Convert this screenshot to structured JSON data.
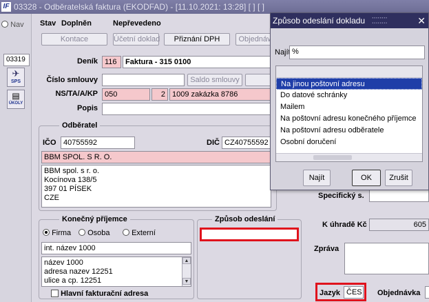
{
  "window": {
    "app_icon": "IF",
    "title": "03328 - Odběratelská faktura (EKODFAD) - [11.10.2021: 13:28]  [ ]  [ ]"
  },
  "left": {
    "nav_label": "Nav",
    "doc_number": "03319",
    "sps_label": "SPS",
    "ukoly_label": "ÚKOLY"
  },
  "status": {
    "stav_label": "Stav",
    "stav_value": "Doplněn",
    "prevod_value": "Nepřevedeno"
  },
  "toolbar": {
    "kontace": "Kontace",
    "ucetni_doklad": "Účetní doklad",
    "priznani_dph": "Přiznání DPH",
    "objednavky": "Objednáv"
  },
  "header": {
    "denik_label": "Deník",
    "denik_code": "116",
    "denik_name": "Faktura - 315 0100",
    "cislo_smlouvy_label": "Číslo smlouvy",
    "cislo_smlouvy_value": "",
    "saldo_button": "Saldo smlouvy",
    "ns_label": "NS/TA/A/KP",
    "ns_value": "050",
    "ta_value": "2",
    "a_value": "1009 zakázka 8786",
    "popis_label": "Popis",
    "popis_value": ""
  },
  "odberatel": {
    "title": "Odběratel",
    "ico_label": "IČO",
    "ico_value": "40755592",
    "dic_label": "DIČ",
    "dic_value": "CZ40755592",
    "name": "BBM SPOL. S R. O.",
    "address_lines": [
      "BBM spol. s r. o.",
      "Kocínova 138/5",
      "397 01 PÍSEK",
      "CZE"
    ]
  },
  "konecny_prijemce": {
    "title": "Konečný příjemce",
    "options": [
      "Firma",
      "Osoba",
      "Externí"
    ],
    "selected": "Firma",
    "name_value": "int. název 1000",
    "address_lines": [
      "název 1000",
      "adresa nazev 12251",
      "ulice a cp. 12251"
    ],
    "hlavni_label": "Hlavní fakturační adresa"
  },
  "zpusob_odeslani": {
    "title": "Způsob odeslání",
    "value": ""
  },
  "right": {
    "specificky_label": "Specifický s.",
    "k_uhrade_label": "K úhradě Kč",
    "k_uhrade_value": "605",
    "zprava_label": "Zpráva",
    "jazyk_label": "Jazyk",
    "jazyk_value": "ČES",
    "objednavka_label": "Objednávka"
  },
  "dialog": {
    "title": "Způsob odeslání dokladu",
    "najit_label": "Najít",
    "search_value": "%",
    "items": [
      "Na jinou poštovní adresu",
      "Do datové schránky",
      "Mailem",
      "Na poštovní adresu konečného příjemce",
      "Na poštovní adresu odběratele",
      "Osobní doručení"
    ],
    "selected_index": 0,
    "btn_najit": "Najít",
    "btn_ok": "OK",
    "btn_zrusit": "Zrušit"
  }
}
